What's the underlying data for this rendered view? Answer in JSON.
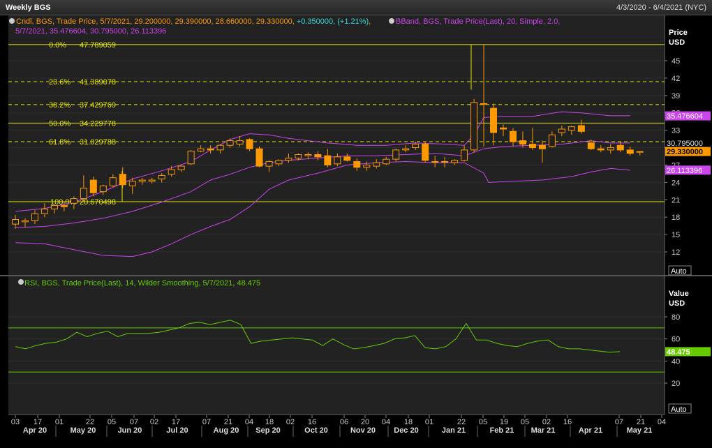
{
  "window": {
    "title": "Weekly BGS",
    "date_range": "4/3/2020 - 6/4/2021 (NYC)"
  },
  "colors": {
    "candle": "#ff9900",
    "bband": "#cc44ee",
    "fib": "#e6e600",
    "rsi": "#66cc00",
    "change": "#33dddd"
  },
  "price_panel": {
    "axis_title": "Price",
    "axis_unit": "USD",
    "auto_label": "Auto",
    "legend": {
      "candle_prefix": "Cndl, BGS, Trade Price,  5/7/2021, 29.200000, 29.390000, 28.660000, 29.330000, ",
      "candle_change": "+0.350000,  (+1.21%)",
      "candle_suffix": ", ",
      "bband_line1": "BBand, BGS, Trade Price(Last),  20, Simple, 2.0,",
      "bband_line2": "5/7/2021, 35.476604, 30.795000, 26.113396"
    },
    "ticks": [
      "45",
      "42",
      "39",
      "36",
      "33",
      "30",
      "27",
      "24",
      "21",
      "18",
      "15",
      "12"
    ],
    "value_tags": {
      "bband_upper": "35.476604",
      "bband_mid": "30.795000",
      "last_price": "29.330000",
      "bband_lower": "26.113396"
    },
    "fib_levels": [
      {
        "pct": "0.0%",
        "value": "47.789059",
        "price": 47.789059,
        "dashed": false
      },
      {
        "pct": "23.6%",
        "value": "41.389078",
        "price": 41.389078,
        "dashed": true
      },
      {
        "pct": "38.2%",
        "value": "37.429769",
        "price": 37.429769,
        "dashed": true
      },
      {
        "pct": "50.0%",
        "value": "34.229778",
        "price": 34.229778,
        "dashed": false
      },
      {
        "pct": "61.8%",
        "value": "31.029788",
        "price": 31.029788,
        "dashed": true
      },
      {
        "pct": "100.0%",
        "value": "20.670498",
        "price": 20.670498,
        "dashed": false
      }
    ]
  },
  "rsi_panel": {
    "legend": "RSI, BGS, Trade Price(Last),  14, Wilder Smoothing, 5/7/2021, 48.475",
    "axis_title": "Value",
    "axis_unit": "USD",
    "auto_label": "Auto",
    "ticks": [
      "80",
      "60",
      "40",
      "20"
    ],
    "value_tag": "48.475",
    "bands": [
      70,
      30
    ]
  },
  "x_axis": {
    "day_ticks": [
      "03",
      "17",
      "01",
      "22",
      "05",
      "07",
      "02",
      "17",
      "07",
      "21",
      "04",
      "18",
      "02",
      "16",
      "06",
      "20",
      "04",
      "18",
      "01",
      "22",
      "05",
      "19",
      "05",
      "02",
      "16",
      "07",
      "21",
      "04"
    ],
    "month_labels": [
      "Apr 20",
      "May 20",
      "Jun 20",
      "Jul 20",
      "Aug 20",
      "Sep 20",
      "Oct 20",
      "Nov 20",
      "Dec 20",
      "Jan 21",
      "Feb 21",
      "Mar 21",
      "Apr 21",
      "May 21"
    ]
  },
  "chart_data": {
    "type": "candlestick",
    "title": "Weekly BGS",
    "x_start": "2020-04-03",
    "x_end": "2021-06-04",
    "ylabel": "Price USD",
    "ylim": [
      9.5,
      49.5
    ],
    "candles": [
      [
        16.8,
        18.4,
        16.0,
        17.6
      ],
      [
        17.2,
        17.8,
        16.2,
        17.4
      ],
      [
        17.4,
        19.2,
        16.8,
        18.6
      ],
      [
        18.6,
        20.4,
        18.0,
        19.4
      ],
      [
        19.4,
        20.2,
        18.6,
        20.0
      ],
      [
        20.0,
        20.6,
        19.0,
        19.8
      ],
      [
        20.4,
        21.6,
        19.4,
        21.2
      ],
      [
        21.2,
        25.2,
        20.8,
        23.0
      ],
      [
        24.4,
        25.0,
        21.6,
        22.2
      ],
      [
        22.4,
        23.6,
        21.8,
        23.4
      ],
      [
        23.4,
        25.4,
        23.2,
        24.8
      ],
      [
        25.4,
        26.6,
        23.0,
        23.6
      ],
      [
        23.4,
        24.8,
        22.0,
        24.2
      ],
      [
        24.2,
        24.8,
        23.6,
        24.4
      ],
      [
        24.2,
        24.8,
        23.8,
        24.4
      ],
      [
        24.6,
        25.6,
        24.0,
        25.2
      ],
      [
        25.4,
        26.8,
        25.0,
        26.2
      ],
      [
        26.2,
        27.0,
        25.8,
        26.8
      ],
      [
        27.2,
        29.6,
        27.0,
        29.4
      ],
      [
        29.4,
        30.4,
        29.2,
        29.8
      ],
      [
        29.8,
        30.4,
        29.0,
        29.6
      ],
      [
        29.6,
        30.6,
        29.0,
        30.4
      ],
      [
        30.4,
        31.6,
        30.0,
        31.2
      ],
      [
        30.6,
        32.0,
        30.2,
        31.2
      ],
      [
        31.4,
        31.6,
        29.4,
        29.8
      ],
      [
        29.8,
        30.2,
        26.6,
        26.8
      ],
      [
        26.8,
        27.8,
        25.8,
        27.6
      ],
      [
        27.2,
        28.0,
        26.8,
        27.8
      ],
      [
        27.8,
        29.0,
        27.4,
        28.2
      ],
      [
        28.2,
        29.0,
        27.8,
        28.8
      ],
      [
        28.6,
        29.2,
        28.0,
        28.8
      ],
      [
        28.8,
        29.4,
        27.8,
        28.4
      ],
      [
        28.6,
        29.8,
        26.6,
        27.0
      ],
      [
        27.2,
        29.0,
        26.8,
        28.4
      ],
      [
        28.4,
        29.0,
        27.6,
        27.8
      ],
      [
        27.6,
        28.2,
        26.0,
        26.6
      ],
      [
        26.6,
        27.6,
        26.0,
        27.0
      ],
      [
        26.8,
        28.0,
        26.4,
        27.4
      ],
      [
        27.2,
        28.4,
        27.0,
        28.0
      ],
      [
        28.0,
        29.8,
        27.6,
        29.6
      ],
      [
        29.6,
        30.4,
        29.2,
        29.8
      ],
      [
        30.0,
        31.0,
        29.6,
        30.6
      ],
      [
        30.6,
        31.0,
        27.4,
        27.8
      ],
      [
        27.6,
        28.6,
        26.6,
        27.6
      ],
      [
        27.6,
        28.4,
        26.6,
        27.6
      ],
      [
        27.4,
        28.0,
        27.0,
        27.8
      ],
      [
        27.8,
        30.4,
        27.6,
        29.6
      ],
      [
        29.6,
        38.4,
        29.2,
        37.8
      ],
      [
        37.6,
        47.8,
        30.2,
        37.6
      ],
      [
        36.8,
        37.6,
        30.4,
        32.6
      ],
      [
        33.4,
        34.0,
        32.0,
        33.2
      ],
      [
        32.8,
        33.4,
        30.2,
        31.0
      ],
      [
        31.2,
        32.8,
        30.0,
        30.6
      ],
      [
        30.6,
        33.4,
        29.6,
        30.0
      ],
      [
        30.4,
        31.2,
        27.4,
        29.8
      ],
      [
        30.2,
        32.8,
        30.0,
        32.2
      ],
      [
        32.6,
        33.8,
        32.0,
        33.2
      ],
      [
        33.0,
        33.8,
        32.2,
        33.6
      ],
      [
        33.8,
        34.8,
        32.4,
        32.8
      ],
      [
        30.8,
        31.4,
        29.6,
        29.8
      ],
      [
        29.8,
        30.4,
        29.2,
        29.6
      ],
      [
        29.6,
        30.6,
        29.0,
        30.0
      ],
      [
        30.4,
        31.0,
        29.2,
        29.6
      ],
      [
        29.6,
        30.2,
        28.6,
        29.0
      ],
      [
        29.2,
        29.39,
        28.66,
        29.33
      ]
    ],
    "bband_upper": [
      [
        0,
        19.0
      ],
      [
        3,
        19.5
      ],
      [
        6,
        20.6
      ],
      [
        9,
        22.4
      ],
      [
        12,
        24.6
      ],
      [
        15,
        26.0
      ],
      [
        18,
        27.6
      ],
      [
        20,
        29.6
      ],
      [
        22,
        31.4
      ],
      [
        24,
        32.4
      ],
      [
        26,
        32.2
      ],
      [
        28,
        31.6
      ],
      [
        30,
        31.2
      ],
      [
        32,
        30.8
      ],
      [
        35,
        30.4
      ],
      [
        38,
        30.4
      ],
      [
        41,
        30.8
      ],
      [
        44,
        30.6
      ],
      [
        46,
        30.4
      ],
      [
        47,
        32.2
      ],
      [
        48,
        35.2
      ],
      [
        50,
        35.4
      ],
      [
        53,
        35.4
      ],
      [
        56,
        36.2
      ],
      [
        58,
        36.0
      ],
      [
        61,
        35.5
      ],
      [
        63,
        35.5
      ]
    ],
    "bband_mid": [
      [
        0,
        16.2
      ],
      [
        3,
        16.4
      ],
      [
        6,
        17.0
      ],
      [
        9,
        17.8
      ],
      [
        12,
        19.0
      ],
      [
        15,
        20.6
      ],
      [
        18,
        22.4
      ],
      [
        20,
        24.4
      ],
      [
        22,
        25.4
      ],
      [
        24,
        26.6
      ],
      [
        26,
        27.4
      ],
      [
        28,
        27.8
      ],
      [
        31,
        28.2
      ],
      [
        34,
        28.6
      ],
      [
        37,
        28.6
      ],
      [
        40,
        28.8
      ],
      [
        43,
        29.0
      ],
      [
        46,
        28.6
      ],
      [
        48,
        29.8
      ],
      [
        50,
        30.2
      ],
      [
        53,
        30.4
      ],
      [
        56,
        30.6
      ],
      [
        59,
        31.2
      ],
      [
        61,
        30.8
      ],
      [
        63,
        30.8
      ]
    ],
    "bband_lower": [
      [
        0,
        13.6
      ],
      [
        3,
        13.4
      ],
      [
        6,
        12.4
      ],
      [
        9,
        11.4
      ],
      [
        12,
        11.2
      ],
      [
        14,
        12.0
      ],
      [
        16,
        13.4
      ],
      [
        18,
        15.0
      ],
      [
        20,
        16.4
      ],
      [
        22,
        17.6
      ],
      [
        24,
        19.8
      ],
      [
        26,
        22.8
      ],
      [
        28,
        24.4
      ],
      [
        31,
        25.6
      ],
      [
        34,
        27.0
      ],
      [
        37,
        27.4
      ],
      [
        40,
        27.6
      ],
      [
        43,
        27.4
      ],
      [
        46,
        27.4
      ],
      [
        48,
        25.6
      ],
      [
        48.5,
        24.0
      ],
      [
        51,
        24.2
      ],
      [
        54,
        24.4
      ],
      [
        57,
        25.0
      ],
      [
        59,
        25.8
      ],
      [
        61,
        26.4
      ],
      [
        63,
        26.1
      ]
    ],
    "rsi": [
      53,
      51,
      54,
      56,
      57,
      60,
      66,
      62,
      65,
      67,
      62,
      65,
      65,
      65,
      66,
      68,
      70,
      74,
      75,
      73,
      75,
      77,
      73,
      56,
      58,
      59,
      60,
      61,
      60,
      59,
      54,
      60,
      55,
      51,
      52,
      54,
      56,
      60,
      61,
      63,
      52,
      51,
      53,
      60,
      74,
      59,
      59,
      56,
      54,
      53,
      56,
      58,
      59,
      53,
      51,
      51,
      50,
      49,
      48,
      48.475
    ]
  }
}
